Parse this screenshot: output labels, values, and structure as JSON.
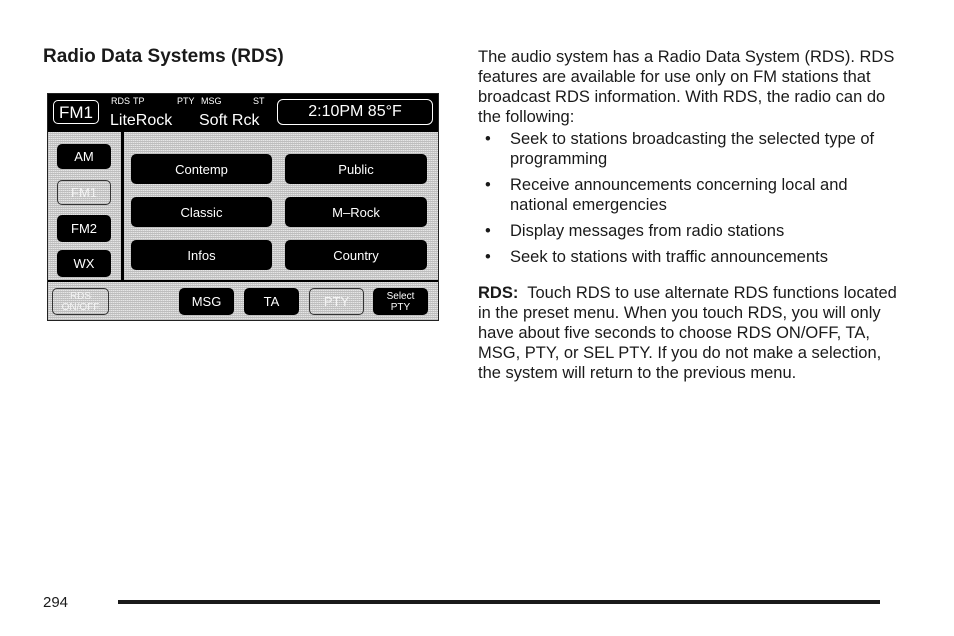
{
  "section_title": "Radio Data Systems (RDS)",
  "display": {
    "band": "FM1",
    "indicators": {
      "rds": "RDS",
      "tp": "TP",
      "pty": "PTY",
      "msg": "MSG",
      "st": "ST"
    },
    "station_name": "LiteRock",
    "program_type": "Soft Rck",
    "clock": "2:10PM 85°F",
    "band_buttons": [
      {
        "label": "AM",
        "state": "normal"
      },
      {
        "label": "FM1",
        "state": "selected"
      },
      {
        "label": "FM2",
        "state": "normal"
      },
      {
        "label": "WX",
        "state": "normal"
      }
    ],
    "pty_buttons": [
      "Contemp",
      "Public",
      "Classic",
      "M–Rock",
      "Infos",
      "Country"
    ],
    "bottom_buttons": [
      {
        "label": "RDS ON/OFF",
        "state": "selected"
      },
      {
        "label": "MSG",
        "state": "normal"
      },
      {
        "label": "TA",
        "state": "normal"
      },
      {
        "label": "PTY",
        "state": "selected"
      },
      {
        "label": "Select PTY",
        "state": "normal"
      }
    ]
  },
  "body": {
    "intro": "The audio system has a Radio Data System (RDS). RDS features are available for use only on FM stations that broadcast RDS information. With RDS, the radio can do the following:",
    "bullet_char": "•",
    "bullets": [
      "Seek to stations broadcasting the selected type of programming",
      "Receive announcements concerning local and national emergencies",
      "Display messages from radio stations",
      "Seek to stations with traffic announcements"
    ],
    "rds_label": "RDS:",
    "rds_text": "Touch RDS to use alternate RDS functions located in the preset menu. When you touch RDS, you will only have about five seconds to choose RDS ON/OFF, TA, MSG, PTY, or SEL PTY. If you do not make a selection, the system will return to the previous menu."
  },
  "page_number": "294"
}
